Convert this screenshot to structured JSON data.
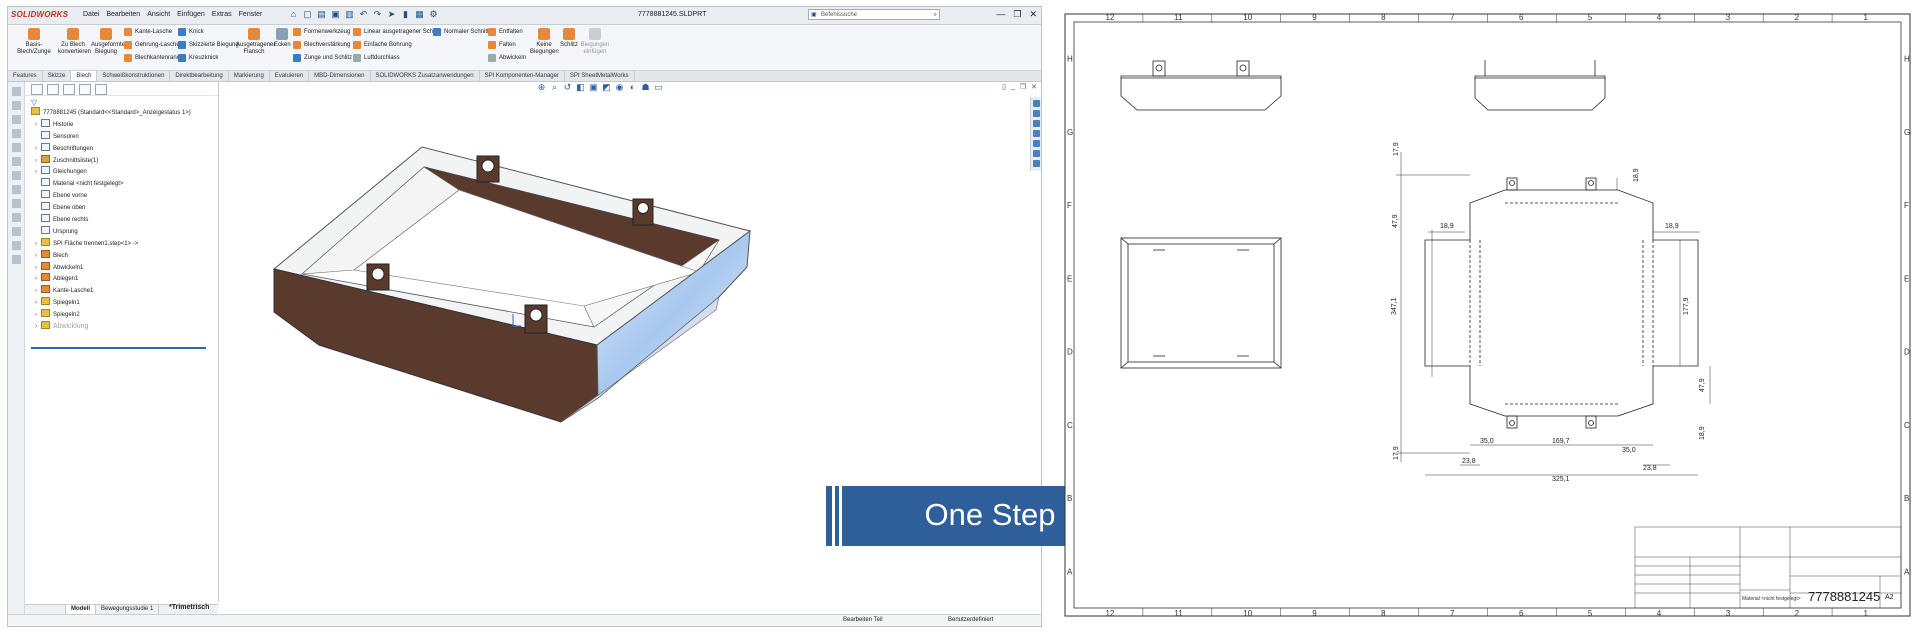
{
  "app": {
    "logo": "SOLIDWORKS",
    "menus": [
      "Datei",
      "Bearbeiten",
      "Ansicht",
      "Einfügen",
      "Extras",
      "Fenster"
    ],
    "document_title": "7778881245.SLDPRT",
    "search_placeholder": "Befehlssuche",
    "window_controls": [
      "—",
      "❐",
      "✕"
    ]
  },
  "ribbon": {
    "big_buttons": [
      "Basis-Blech/Zunge",
      "Zu Blech konvertieren",
      "Ausgeformte Biegung",
      "Ausgetragener Flansch",
      "Ecken",
      "Keine Biegungen",
      "Schlitz",
      "Biegungen einfügen"
    ],
    "small_items": [
      "Kante-Lasche",
      "Gehrung-Lasche",
      "Blechkantenrand",
      "Knick",
      "Skizzierte Biegung",
      "Kreuzknick",
      "Formenwerkzeug",
      "Blechverstärkung",
      "Zunge und Schlitz",
      "Linear ausgetragener Schnitt",
      "Einfache Bohrung",
      "Luftdurchlass",
      "Normaler Schnitt",
      "Entfalten",
      "Falten",
      "Abwickeln"
    ]
  },
  "tabs": [
    "Features",
    "Skizze",
    "Blech",
    "Schweißkonstruktionen",
    "Direktbearbeitung",
    "Markierung",
    "Evaluieren",
    "MBD-Dimensionen",
    "SOLIDWORKS Zusatzanwendungen",
    "SPI Komponenten-Manager",
    "SPI SheetMetalWorks"
  ],
  "active_tab": "Blech",
  "tree": {
    "root": "7778881245 (Standard<<Standard>_Anzeigestatus 1>)",
    "items": [
      "Historie",
      "Sensoren",
      "Beschriftungen",
      "Zuschnittsliste(1)",
      "Gleichungen",
      "Material <nicht festgelegt>",
      "Ebene vorne",
      "Ebene oben",
      "Ebene rechts",
      "Ursprung",
      "SPI Fläche trennen1.step<1> ->",
      "Blech",
      "Abwickeln1",
      "Ablegen1",
      "Kante-Lasche1",
      "Spiegeln1",
      "Spiegeln2",
      "Abwicklung"
    ],
    "bottom_tabs": [
      "Modell",
      "Bewegungsstudie 1"
    ]
  },
  "viewport": {
    "view_label": "*Trimetrisch"
  },
  "statusbar": {
    "mode": "Bearbeiten Teil",
    "units": "Benutzerdefiniert"
  },
  "arrow": {
    "label": "One Step",
    "color": "#2e5f9b"
  },
  "drawing": {
    "columns": [
      "12",
      "11",
      "10",
      "9",
      "8",
      "7",
      "6",
      "5",
      "4",
      "3",
      "2",
      "1"
    ],
    "rows": [
      "H",
      "G",
      "F",
      "E",
      "D",
      "C",
      "B",
      "A"
    ],
    "dimensions": [
      "17,9",
      "18,9",
      "47,9",
      "18,9",
      "18,9",
      "347,1",
      "177,9",
      "47,9",
      "18,9",
      "17,9",
      "35,0",
      "169,7",
      "35,0",
      "23,8",
      "23,8",
      "325,1"
    ],
    "title_block": {
      "drawing_number": "7778881245",
      "sheet_size": "A2",
      "material": "Material <nicht festgelegt>"
    }
  }
}
